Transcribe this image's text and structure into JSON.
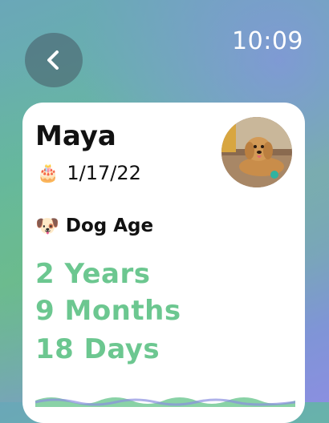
{
  "status": {
    "time": "10:09"
  },
  "navigation": {
    "back_icon": "chevron-left-icon"
  },
  "pet": {
    "name": "Maya",
    "birthday_icon": "🎂",
    "birthday": "1/17/22",
    "photo_icon": "dog-photo"
  },
  "dog_age": {
    "icon": "🐶",
    "title": "Dog Age",
    "years": "2 Years",
    "months": "9 Months",
    "days": "18 Days"
  },
  "colors": {
    "accent_green": "#6cc790",
    "card_background": "#ffffff"
  }
}
